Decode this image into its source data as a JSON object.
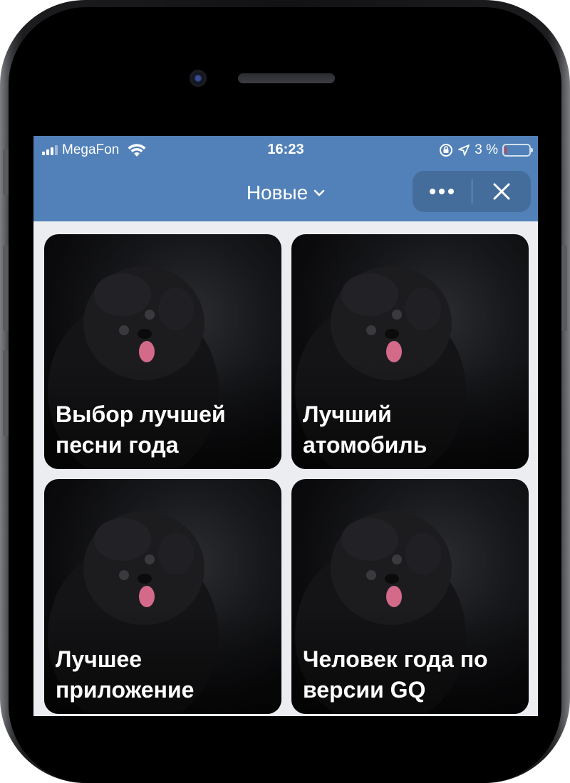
{
  "status_bar": {
    "carrier": "MegaFon",
    "time": "16:23",
    "battery_percent": "3 %",
    "battery_level": 0.03
  },
  "nav": {
    "title": "Новые"
  },
  "cards": [
    {
      "title": "Выбор лучшей песни года"
    },
    {
      "title": "Лучший атомобиль"
    },
    {
      "title": "Лучшее приложение"
    },
    {
      "title": "Человек года по версии GQ"
    }
  ],
  "colors": {
    "header": "#5181b8",
    "background": "#ebedf0",
    "battery_low": "#e8323c"
  },
  "icons": [
    "signal-icon",
    "wifi-icon",
    "orientation-lock-icon",
    "location-arrow-icon",
    "battery-icon",
    "chevron-down-icon",
    "more-icon",
    "close-icon"
  ]
}
